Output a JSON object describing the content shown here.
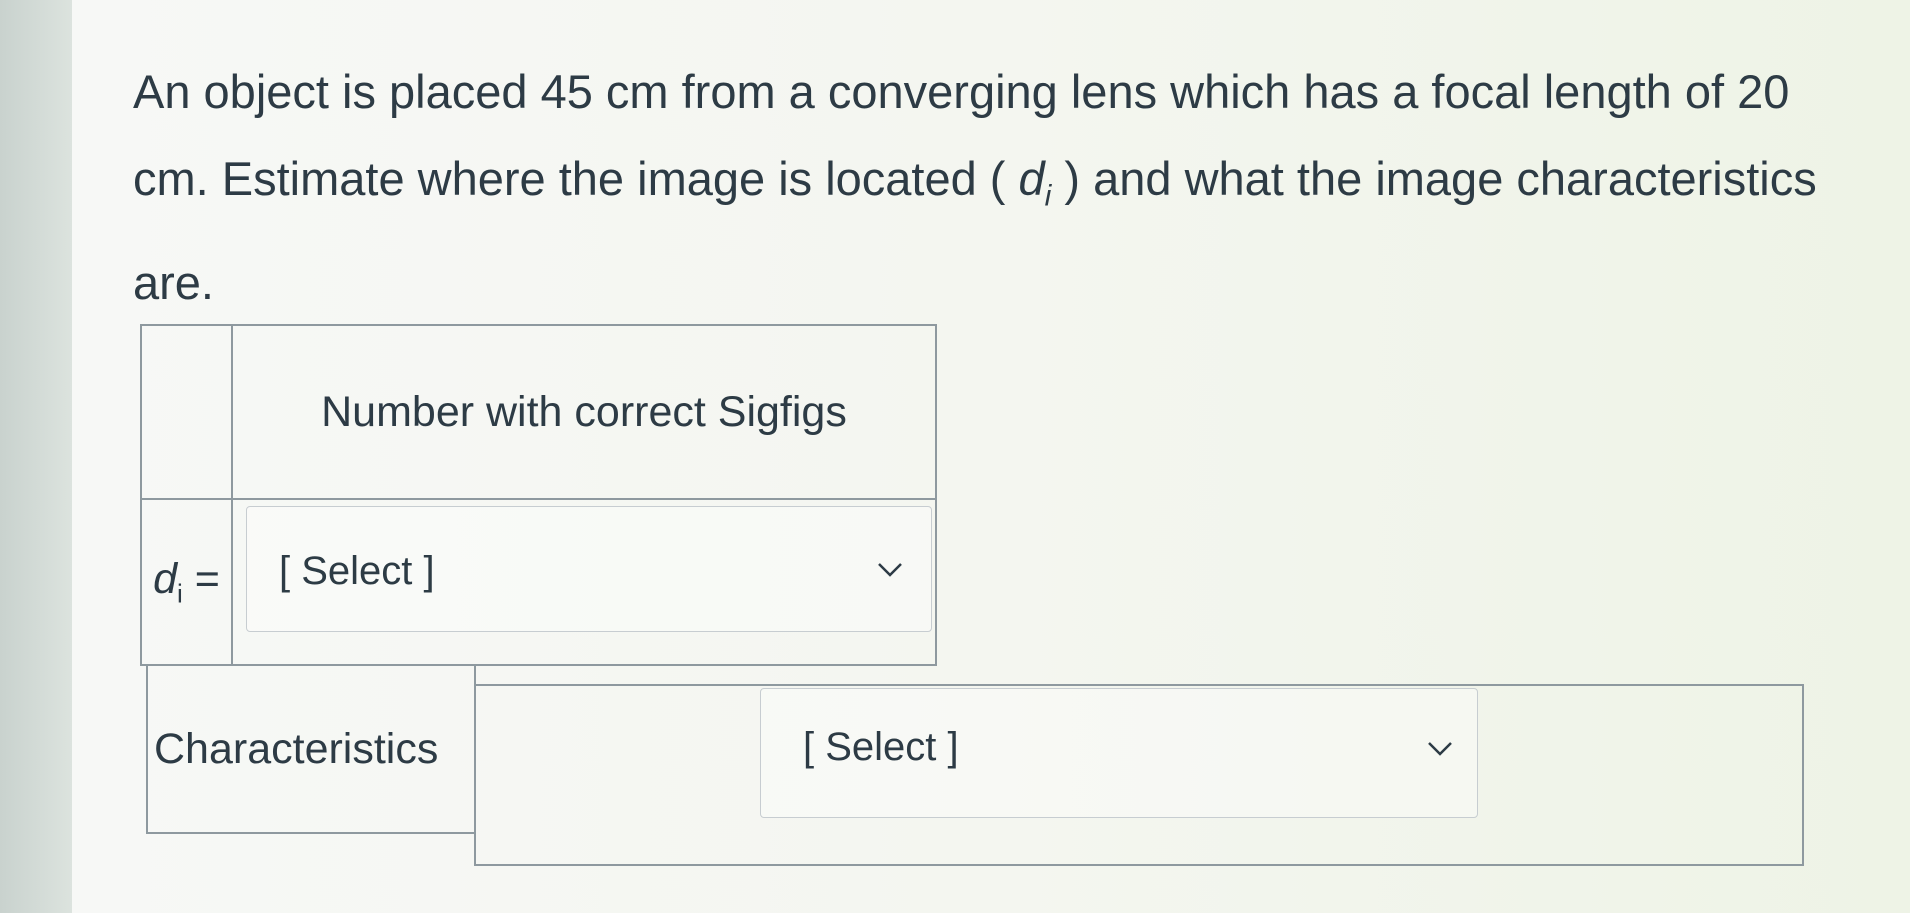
{
  "question": {
    "part1": "An object is placed 45 cm from a converging lens which has a focal length of 20 cm. Estimate where the image is located ( ",
    "symbol_d": "d",
    "symbol_sub": "i",
    "part2": " ) and what the image characteristics are."
  },
  "table1": {
    "header": "Number with correct Sigfigs",
    "row_label_d": "d",
    "row_label_sub": "i",
    "row_label_eq": " =",
    "select_value": "[ Select ]"
  },
  "table2": {
    "row_label": "Characteristics",
    "select_value": "[ Select ]"
  },
  "icons": {
    "dropdown": "chevron-down-icon"
  }
}
